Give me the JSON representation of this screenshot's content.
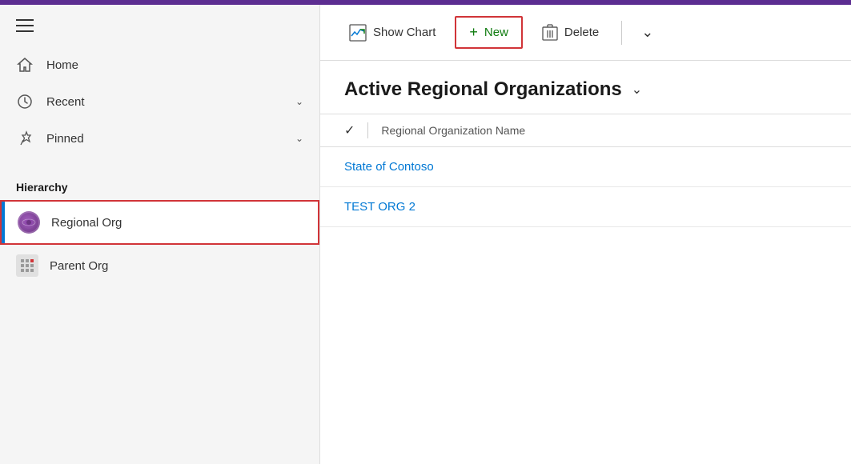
{
  "topBar": {
    "color": "#5c2d91"
  },
  "sidebar": {
    "hamburger": "menu",
    "navItems": [
      {
        "id": "home",
        "label": "Home",
        "icon": "home",
        "hasChevron": false
      },
      {
        "id": "recent",
        "label": "Recent",
        "icon": "recent",
        "hasChevron": true
      },
      {
        "id": "pinned",
        "label": "Pinned",
        "icon": "pin",
        "hasChevron": true
      }
    ],
    "hierarchyTitle": "Hierarchy",
    "hierarchyItems": [
      {
        "id": "regional-org",
        "label": "Regional Org",
        "iconType": "globe",
        "active": true
      },
      {
        "id": "parent-org",
        "label": "Parent Org",
        "iconType": "grid",
        "active": false
      }
    ]
  },
  "toolbar": {
    "showChartLabel": "Show Chart",
    "newLabel": "New",
    "deleteLabel": "Delete"
  },
  "main": {
    "pageTitle": "Active Regional Organizations",
    "columnHeader": "Regional Organization Name",
    "listItems": [
      {
        "id": "item-1",
        "label": "State of Contoso"
      },
      {
        "id": "item-2",
        "label": "TEST ORG 2"
      }
    ]
  }
}
